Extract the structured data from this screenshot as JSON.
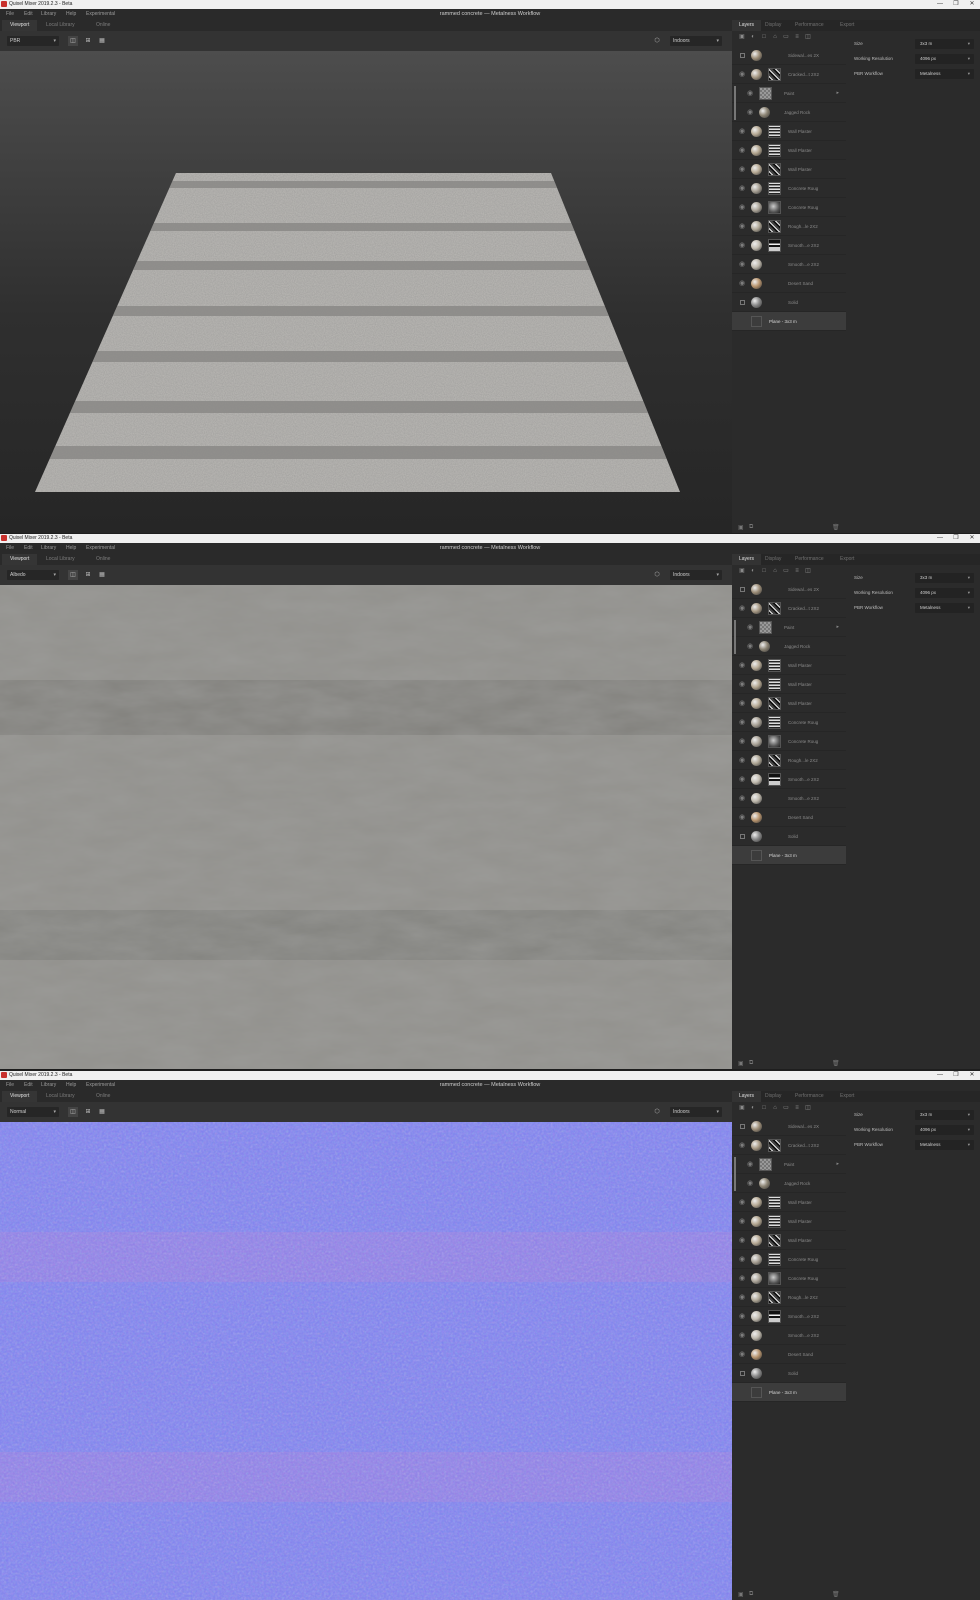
{
  "app_title": "Quixel Mixer 2019.2.3 - Beta",
  "document_title": "rammed concrete — Metalness Workflow",
  "menu": [
    "File",
    "Edit",
    "Library",
    "Help",
    "Experimental"
  ],
  "window_controls": [
    "—",
    "❐",
    "✕"
  ],
  "tabs": [
    "Viewport",
    "Local Library",
    "Online"
  ],
  "panel_tabs": [
    "Layers",
    "Display",
    "Performance",
    "Export"
  ],
  "environment": "Indoors",
  "view_modes": [
    "PBR",
    "Albedo",
    "Normal"
  ],
  "layers": [
    {
      "name": "Sidewal...es 2X",
      "visible": false,
      "thumb": "none",
      "sphere": "#9d8e78"
    },
    {
      "name": "Cracked...t 2X2",
      "visible": true,
      "thumb": "mask-noise",
      "sphere": "#a89a85"
    },
    {
      "name": "Paint",
      "visible": true,
      "thumb": "checker",
      "sphere": "",
      "indent": true,
      "arrow": true
    },
    {
      "name": "Jagged Rock",
      "visible": true,
      "thumb": "none",
      "sphere": "#8c8474",
      "indent": true
    },
    {
      "name": "Wall Plaster",
      "visible": true,
      "thumb": "mask-lines",
      "sphere": "#b7aa95"
    },
    {
      "name": "Wall Plaster",
      "visible": true,
      "thumb": "mask-lines",
      "sphere": "#b2a58f"
    },
    {
      "name": "Wall Plaster",
      "visible": true,
      "thumb": "mask-noise",
      "sphere": "#b8ab96"
    },
    {
      "name": "Concrete Roug",
      "visible": true,
      "thumb": "mask-lines",
      "sphere": "#a7a094"
    },
    {
      "name": "Concrete Roug",
      "visible": true,
      "thumb": "mask-soft",
      "sphere": "#aca599"
    },
    {
      "name": "Rough...le 2X2",
      "visible": true,
      "thumb": "mask-noise",
      "sphere": "#b0a897"
    },
    {
      "name": "Smooth...e 2X2",
      "visible": true,
      "thumb": "mask-dark",
      "sphere": "#c2bcb0"
    },
    {
      "name": "Smooth...e 2X2",
      "visible": true,
      "thumb": "none",
      "sphere": "#bdb7ab"
    },
    {
      "name": "Desert Sand",
      "visible": true,
      "thumb": "none",
      "sphere": "#b9956e"
    },
    {
      "name": "Solid",
      "visible": false,
      "thumb": "none",
      "sphere": "#8a8a8a"
    }
  ],
  "base_layer": "Plane - 3x3 m",
  "properties": [
    {
      "label": "Size",
      "value": "3x3 m"
    },
    {
      "label": "Working Resolution",
      "value": "4096 px"
    },
    {
      "label": "PBR Workflow",
      "value": "Metalness"
    }
  ],
  "colors": {
    "accent_red": "#c8302c",
    "panel_bg": "#2b2b2b",
    "normal_map_base": "#7d80ee",
    "albedo_base": "#8c8c8a"
  }
}
